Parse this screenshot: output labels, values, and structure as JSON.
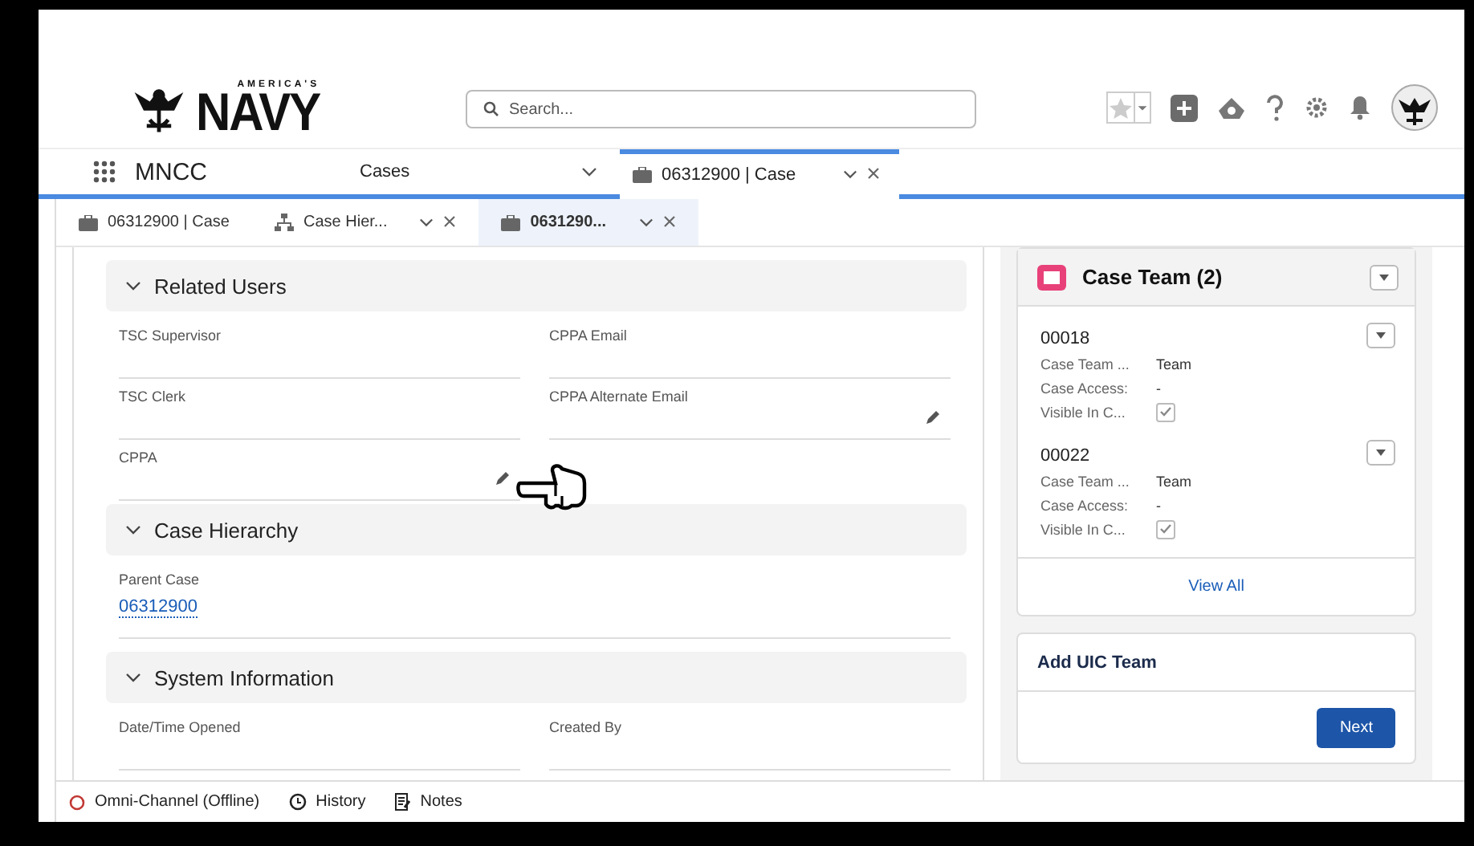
{
  "header": {
    "logo": {
      "top": "AMERICA'S",
      "word": "NAVY"
    },
    "search": {
      "placeholder": "Search..."
    }
  },
  "nav": {
    "app_name": "MNCC",
    "object": "Cases",
    "tabs": [
      {
        "label": "06312900 | Case",
        "selected": true
      }
    ]
  },
  "subtabs": [
    {
      "label": "06312900 | Case",
      "kind": "case",
      "selected": false,
      "closable": false
    },
    {
      "label": "Case Hier...",
      "kind": "hierarchy",
      "selected": false,
      "closable": true
    },
    {
      "label": "0631290...",
      "kind": "case",
      "selected": true,
      "closable": true
    }
  ],
  "sections": [
    {
      "title": "Related Users",
      "expanded": true,
      "fields": [
        {
          "label": "TSC Supervisor",
          "editable": false
        },
        {
          "label": "CPPA Email",
          "editable": false
        },
        {
          "label": "TSC Clerk",
          "editable": false
        },
        {
          "label": "CPPA Alternate Email",
          "editable": true
        },
        {
          "label": "CPPA",
          "editable": true
        }
      ]
    },
    {
      "title": "Case Hierarchy",
      "expanded": true,
      "fields": [
        {
          "label": "Parent Case",
          "value": "06312900",
          "link": true,
          "editable": false,
          "wide": true
        }
      ]
    },
    {
      "title": "System Information",
      "expanded": true,
      "fields": [
        {
          "label": "Date/Time Opened",
          "editable": false
        },
        {
          "label": "Created By",
          "editable": false
        }
      ]
    }
  ],
  "case_team": {
    "title": "Case Team (2)",
    "members": [
      {
        "id": "00018",
        "rows": [
          {
            "label": "Case Team ...",
            "value": "Team",
            "kind": "text"
          },
          {
            "label": "Case Access:",
            "value": "-",
            "kind": "text"
          },
          {
            "label": "Visible In C...",
            "checked": true,
            "kind": "check"
          }
        ]
      },
      {
        "id": "00022",
        "rows": [
          {
            "label": "Case Team ...",
            "value": "Team",
            "kind": "text"
          },
          {
            "label": "Case Access:",
            "value": "-",
            "kind": "text"
          },
          {
            "label": "Visible In C...",
            "checked": true,
            "kind": "check"
          }
        ]
      }
    ],
    "footer_link": "View All"
  },
  "uic_team": {
    "title": "Add UIC Team",
    "button": "Next"
  },
  "utility_bar": [
    {
      "label": "Omni-Channel (Offline)",
      "kind": "status"
    },
    {
      "label": "History",
      "kind": "history"
    },
    {
      "label": "Notes",
      "kind": "notes"
    }
  ]
}
